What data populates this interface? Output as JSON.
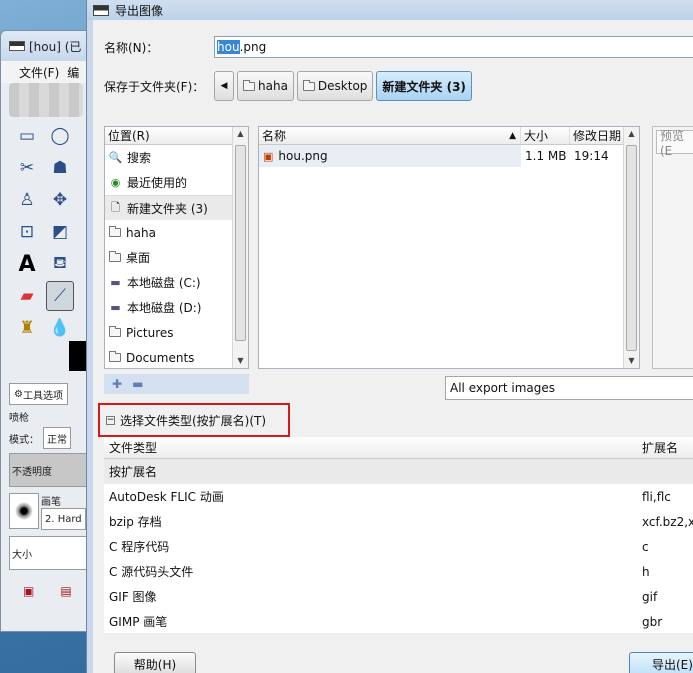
{
  "toolbox": {
    "title": "[hou] (已",
    "menu": [
      "文件(F)",
      "编"
    ],
    "options_tab": "工具选项",
    "tool_name": "喷枪",
    "mode_label": "模式：",
    "mode_value": "正常",
    "opacity_label": "不透明度",
    "brush_label": "画笔",
    "brush_value": "2. Hard",
    "size_label": "大小"
  },
  "dialog": {
    "title": "导出图像",
    "name_label": "名称(N)：",
    "filename_selected": "hou",
    "filename_rest": ".png",
    "folder_label": "保存于文件夹(F)：",
    "breadcrumbs": [
      "haha",
      "Desktop",
      "新建文件夹 (3)"
    ],
    "places": {
      "header": "位置(R)",
      "items": [
        {
          "icon": "search-icon",
          "label": "搜索"
        },
        {
          "icon": "recent-icon",
          "label": "最近使用的"
        },
        {
          "icon": "document-icon",
          "label": "新建文件夹 (3)"
        },
        {
          "icon": "folder-icon",
          "label": "haha"
        },
        {
          "icon": "folder-icon",
          "label": "桌面"
        },
        {
          "icon": "drive-icon",
          "label": "本地磁盘 (C:)"
        },
        {
          "icon": "drive-icon",
          "label": "本地磁盘 (D:)"
        },
        {
          "icon": "folder-icon",
          "label": "Pictures"
        },
        {
          "icon": "folder-icon",
          "label": "Documents"
        }
      ]
    },
    "files": {
      "col_name": "名称",
      "col_size": "大小",
      "col_date": "修改日期",
      "rows": [
        {
          "name": "hou.png",
          "size": "1.1 MB",
          "date": "19:14"
        }
      ]
    },
    "preview_label": "预览(E",
    "filter": "All export images",
    "type_toggle": "选择文件类型(按扩展名)(T)",
    "types": {
      "col_type": "文件类型",
      "col_ext": "扩展名",
      "rows": [
        {
          "type": "按扩展名",
          "ext": ""
        },
        {
          "type": "AutoDesk FLIC 动画",
          "ext": "fli,flc"
        },
        {
          "type": "bzip 存档",
          "ext": "xcf.bz2,x"
        },
        {
          "type": "C 程序代码",
          "ext": "c"
        },
        {
          "type": "C 源代码头文件",
          "ext": "h"
        },
        {
          "type": "GIF 图像",
          "ext": "gif"
        },
        {
          "type": "GIMP 画笔",
          "ext": "gbr"
        }
      ]
    },
    "help_button": "帮助(H)",
    "export_button": "导出(E)"
  },
  "colors": {
    "accent": "#3a86d6",
    "highlight_box": "#d21a1a"
  }
}
